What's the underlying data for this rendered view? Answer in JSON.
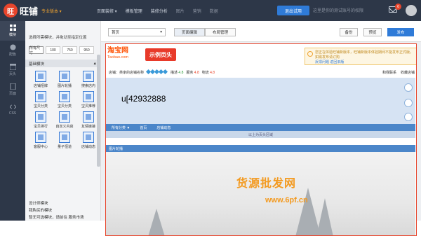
{
  "header": {
    "logo_mark": "旺",
    "app_name": "旺铺",
    "edition": "专业版本 ▾",
    "nav": [
      "页面装修 ▾",
      "模板管理",
      "装修分析",
      "图片",
      "营销",
      "数据"
    ],
    "upgrade_label": "退出试用",
    "tip": "这里是你的测试账号的权限",
    "mail_count": "6"
  },
  "leftnav": [
    {
      "label": "模块",
      "icon": "grid-icon"
    },
    {
      "label": "配色",
      "icon": "palette-icon"
    },
    {
      "label": "页头",
      "icon": "header-icon"
    },
    {
      "label": "页面",
      "icon": "page-icon"
    },
    {
      "label": "CSS",
      "icon": "code-icon"
    }
  ],
  "panel": {
    "title": "选择所需模块，并拖动至指定位置",
    "widths": [
      "所有尺寸",
      "100",
      "750",
      "950"
    ],
    "section_basic": "基础模块",
    "modules": [
      "店铺招牌",
      "图片轮播",
      "搜索店内",
      "宝贝分类",
      "宝贝分类",
      "宝贝推荐",
      "宝贝排行",
      "自定义内容",
      "友情链接",
      "客服中心",
      "量子恒道",
      "店铺动态",
      "",
      "",
      ""
    ],
    "section_design": "设计师模块",
    "section_bought": "我购买的模块",
    "footer_note": "暂无可选模块，请前往 服务市场"
  },
  "toolbar": {
    "page_select": "首页",
    "tab_edit": "页面编辑",
    "tab_layout": "布局管理",
    "backup": "备份",
    "preview": "预览",
    "publish": "发布"
  },
  "shop": {
    "taobao_cn": "淘宝网",
    "taobao_en": "Taobao.com",
    "example_label": "示例页头",
    "notice": "您正在体验旺铺新版本，旺铺新版本体验期间不能发布正式版，如需发布请订购",
    "notice_link": "反馈问题 返回旧版",
    "shop_name": "店铺：类家的店铺名称",
    "describe_label": "描述",
    "describe_value": "4.8",
    "service_label": "服务",
    "service_value": "4.8",
    "logistics_label": "物流",
    "logistics_value": "4.8",
    "contact": "和我联系",
    "favorite": "收藏店铺",
    "banner_text": "u[42932888",
    "menu": [
      "所有分类 ▼",
      "首页",
      "店铺动态"
    ],
    "caption": "以上为页头区域",
    "carousel_title": "图片轮播"
  },
  "watermark": {
    "main": "货源批发网",
    "url": "www.6pf.cn"
  },
  "colors": {
    "brand": "#e8452c",
    "accent": "#2f7bd8",
    "topbar": "#2d3748"
  }
}
